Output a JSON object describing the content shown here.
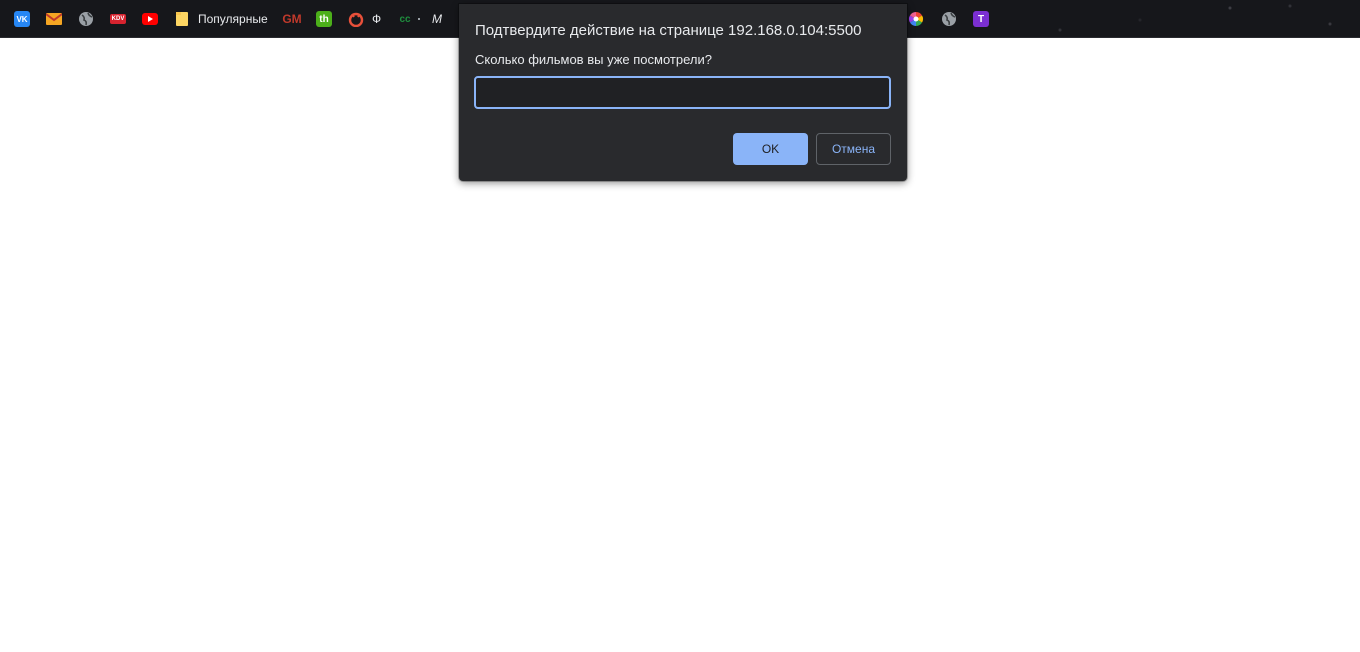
{
  "bookmarks_bar": {
    "items": [
      {
        "id": "vk",
        "icon": "vk-icon",
        "glyph": "VK",
        "color": "#2787f5",
        "label": ""
      },
      {
        "id": "mail",
        "icon": "mail-icon",
        "glyph": "✉",
        "color": "#f5a623",
        "label": ""
      },
      {
        "id": "globe1",
        "icon": "globe-icon",
        "glyph": "◍",
        "color": "#9aa0a6",
        "label": ""
      },
      {
        "id": "kdv",
        "icon": "kdv-icon",
        "glyph": "KDV",
        "color": "#d6232f",
        "label": ""
      },
      {
        "id": "youtube",
        "icon": "youtube-icon",
        "glyph": "▶",
        "color": "#ff0000",
        "label": ""
      },
      {
        "id": "folder",
        "icon": "folder-icon",
        "glyph": "",
        "color": "#fdd663",
        "label": "Популярные"
      },
      {
        "id": "gm",
        "icon": "gm-icon",
        "glyph": "GM",
        "color": "#c0392b",
        "label": ""
      },
      {
        "id": "th",
        "icon": "th-icon",
        "glyph": "th",
        "color": "#4caf1a",
        "label": ""
      },
      {
        "id": "ph",
        "icon": "dragon-icon",
        "glyph": "❦",
        "color": "#e8503a",
        "label": "Ф"
      },
      {
        "id": "cc",
        "icon": "link-icon",
        "glyph": "cc",
        "color": "#1e8e3e",
        "label": ""
      },
      {
        "id": "m",
        "icon": "m-icon",
        "glyph": "M",
        "color": "#9aa0a6",
        "label": ""
      },
      {
        "id": "color",
        "icon": "color-wheel-icon",
        "glyph": "",
        "color": "#ffffff",
        "label": ""
      },
      {
        "id": "globe2",
        "icon": "globe-icon",
        "glyph": "◍",
        "color": "#9aa0a6",
        "label": ""
      },
      {
        "id": "t",
        "icon": "t-icon",
        "glyph": "T",
        "color": "#7b2fd1",
        "label": ""
      }
    ]
  },
  "dialog": {
    "title": "Подтвердите действие на странице 192.168.0.104:5500",
    "message": "Сколько фильмов вы уже посмотрели?",
    "input_value": "",
    "ok_label": "OK",
    "cancel_label": "Отмена"
  },
  "colors": {
    "dialog_bg": "#292a2d",
    "accent": "#8ab4f8",
    "bar_bg": "#16171b",
    "page_bg": "#ffffff"
  }
}
